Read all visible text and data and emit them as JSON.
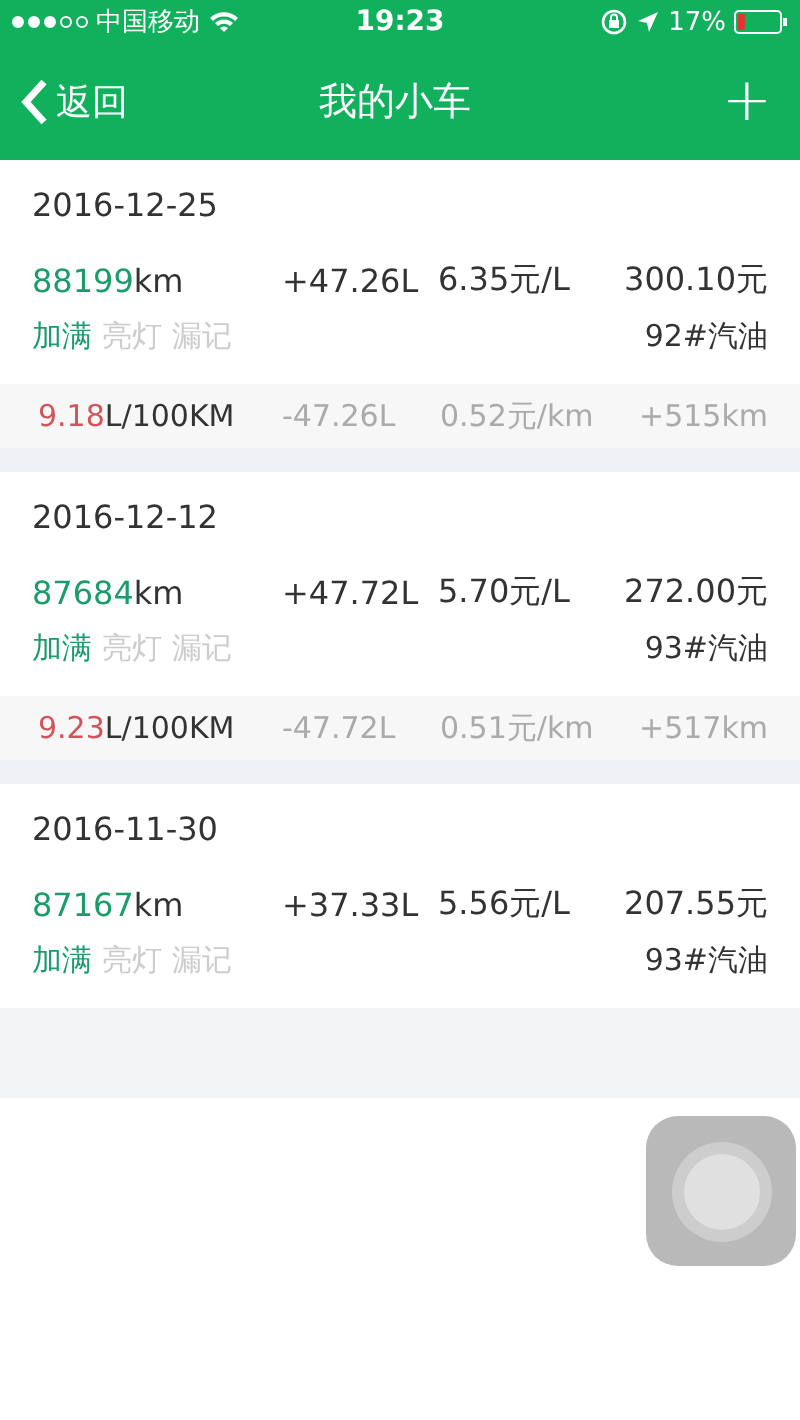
{
  "status_bar": {
    "carrier": "中国移动",
    "time": "19:23",
    "battery": "17%"
  },
  "nav": {
    "back": "返回",
    "title": "我的小车",
    "add": "+"
  },
  "records": [
    {
      "date": "2016-12-25",
      "odometer": {
        "number": "88199",
        "unit": "km"
      },
      "litres": "+47.26L",
      "unit_price": "6.35元/L",
      "total": "300.10元",
      "tags": [
        {
          "label": "加满",
          "on": true
        },
        {
          "label": "亮灯",
          "on": false
        },
        {
          "label": "漏记",
          "on": false
        }
      ],
      "fuel": "92#汽油",
      "summary": {
        "consumption": {
          "value": "9.18",
          "unit": "L/100KM"
        },
        "litres": "-47.26L",
        "cost_per_km": "0.52元/km",
        "distance": "+515km"
      }
    },
    {
      "date": "2016-12-12",
      "odometer": {
        "number": "87684",
        "unit": "km"
      },
      "litres": "+47.72L",
      "unit_price": "5.70元/L",
      "total": "272.00元",
      "tags": [
        {
          "label": "加满",
          "on": true
        },
        {
          "label": "亮灯",
          "on": false
        },
        {
          "label": "漏记",
          "on": false
        }
      ],
      "fuel": "93#汽油",
      "summary": {
        "consumption": {
          "value": "9.23",
          "unit": "L/100KM"
        },
        "litres": "-47.72L",
        "cost_per_km": "0.51元/km",
        "distance": "+517km"
      }
    },
    {
      "date": "2016-11-30",
      "odometer": {
        "number": "87167",
        "unit": "km"
      },
      "litres": "+37.33L",
      "unit_price": "5.56元/L",
      "total": "207.55元",
      "tags": [
        {
          "label": "加满",
          "on": true
        },
        {
          "label": "亮灯",
          "on": false
        },
        {
          "label": "漏记",
          "on": false
        }
      ],
      "fuel": "93#汽油"
    }
  ]
}
